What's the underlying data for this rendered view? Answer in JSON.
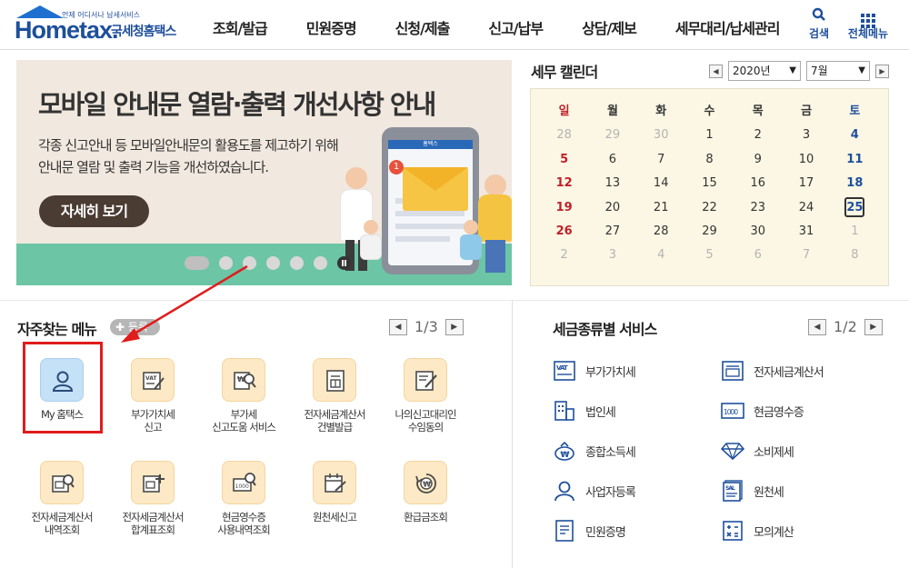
{
  "header": {
    "logo_sub": "언제 어디서나 납세서비스",
    "logo_main": "Hometax.",
    "logo_org": "국세청홈택스",
    "nav": [
      "조회/발급",
      "민원증명",
      "신청/제출",
      "신고/납부",
      "상담/제보",
      "세무대리/납세관리"
    ],
    "search_label": "검색",
    "all_menu_label": "전체메뉴"
  },
  "banner": {
    "title": "모바일 안내문 열람·출력 개선사항 안내",
    "desc_line1": "각종 신고안내 등 모바일안내문의 활용도를 제고하기 위해",
    "desc_line2": "안내문 열람 및 출력 기능을 개선하였습니다.",
    "button": "자세히 보기",
    "phone_brand": "홈택스",
    "badge": "1",
    "slide_count": 7,
    "active_slide": 1
  },
  "calendar": {
    "title": "세무 캘린더",
    "year": "2020년",
    "month": "7월",
    "weekdays": [
      "일",
      "월",
      "화",
      "수",
      "목",
      "금",
      "토"
    ],
    "weeks": [
      [
        "28",
        "29",
        "30",
        "1",
        "2",
        "3",
        "4"
      ],
      [
        "5",
        "6",
        "7",
        "8",
        "9",
        "10",
        "11"
      ],
      [
        "12",
        "13",
        "14",
        "15",
        "16",
        "17",
        "18"
      ],
      [
        "19",
        "20",
        "21",
        "22",
        "23",
        "24",
        "25"
      ],
      [
        "26",
        "27",
        "28",
        "29",
        "30",
        "31",
        "1"
      ],
      [
        "2",
        "3",
        "4",
        "5",
        "6",
        "7",
        "8"
      ]
    ],
    "today": "25"
  },
  "frequent_menu": {
    "title": "자주찾는 메뉴",
    "add_label": "등록",
    "page": "1/3",
    "items": [
      {
        "line1": "My 홈택스",
        "line2": ""
      },
      {
        "line1": "부가가치세",
        "line2": "신고"
      },
      {
        "line1": "부가세",
        "line2": "신고도움 서비스"
      },
      {
        "line1": "전자세금계산서",
        "line2": "건별발급"
      },
      {
        "line1": "나의신고대리인",
        "line2": "수임동의"
      },
      {
        "line1": "전자세금계산서",
        "line2": "내역조회"
      },
      {
        "line1": "전자세금계산서",
        "line2": "합계표조회"
      },
      {
        "line1": "현금영수증",
        "line2": "사용내역조회"
      },
      {
        "line1": "원천세신고",
        "line2": ""
      },
      {
        "line1": "환급금조회",
        "line2": ""
      }
    ]
  },
  "tax_services": {
    "title": "세금종류별 서비스",
    "page": "1/2",
    "items": [
      {
        "label": "부가가치세",
        "icon": "vat-icon"
      },
      {
        "label": "전자세금계산서",
        "icon": "invoice-icon"
      },
      {
        "label": "법인세",
        "icon": "building-icon"
      },
      {
        "label": "현금영수증",
        "icon": "receipt-icon"
      },
      {
        "label": "종합소득세",
        "icon": "money-bag-icon"
      },
      {
        "label": "소비제세",
        "icon": "diamond-icon"
      },
      {
        "label": "사업자등록",
        "icon": "person-icon"
      },
      {
        "label": "원천세",
        "icon": "sal-doc-icon"
      },
      {
        "label": "민원증명",
        "icon": "document-icon"
      },
      {
        "label": "모의계산",
        "icon": "calculator-icon"
      }
    ]
  },
  "colors": {
    "brand": "#1e4f9c",
    "highlight": "#e01c1c",
    "sunday": "#c0202a",
    "saturday": "#1e4f9c",
    "menu_icon_bg": "#fde9c5"
  }
}
